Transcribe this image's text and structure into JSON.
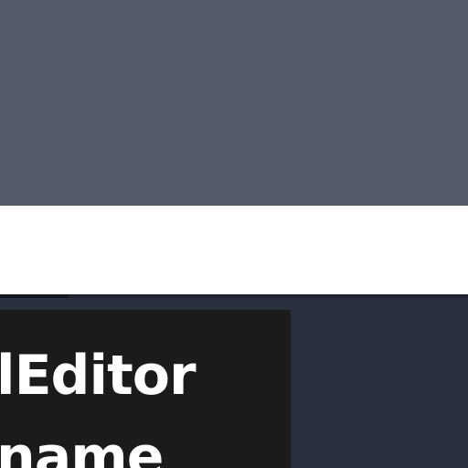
{
  "window": {
    "title_line_1": "lEditor",
    "title_line_2": "name"
  },
  "colors": {
    "top_region": "#545967",
    "white_band": "#ffffff",
    "lower_region": "#2a2f3f",
    "dark_panel": "#1b1b1c",
    "title_text": "#ffffff"
  }
}
